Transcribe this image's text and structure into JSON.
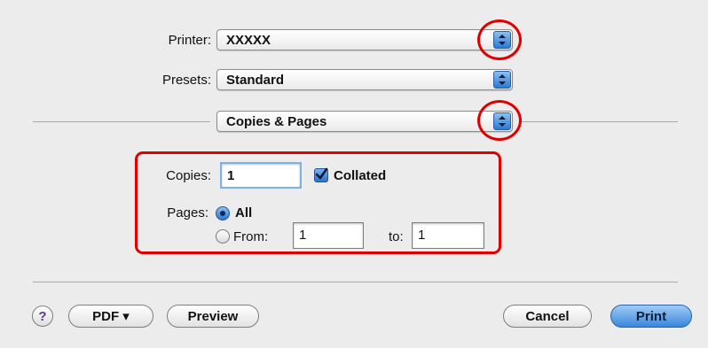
{
  "printer": {
    "label": "Printer:",
    "value": "XXXXX"
  },
  "presets": {
    "label": "Presets:",
    "value": "Standard"
  },
  "section_menu": {
    "value": "Copies & Pages"
  },
  "copies": {
    "label": "Copies:",
    "value": "1",
    "collated_label": "Collated",
    "collated_checked": true
  },
  "pages": {
    "label": "Pages:",
    "all_label": "All",
    "all_selected": true,
    "from_label": "From:",
    "from_value": "1",
    "to_label": "to:",
    "to_value": "1"
  },
  "buttons": {
    "help": "?",
    "pdf": "PDF ▾",
    "preview": "Preview",
    "cancel": "Cancel",
    "print": "Print"
  },
  "colors": {
    "highlight": "#e00000",
    "accent": "#2d78d2",
    "background": "#ececec"
  }
}
